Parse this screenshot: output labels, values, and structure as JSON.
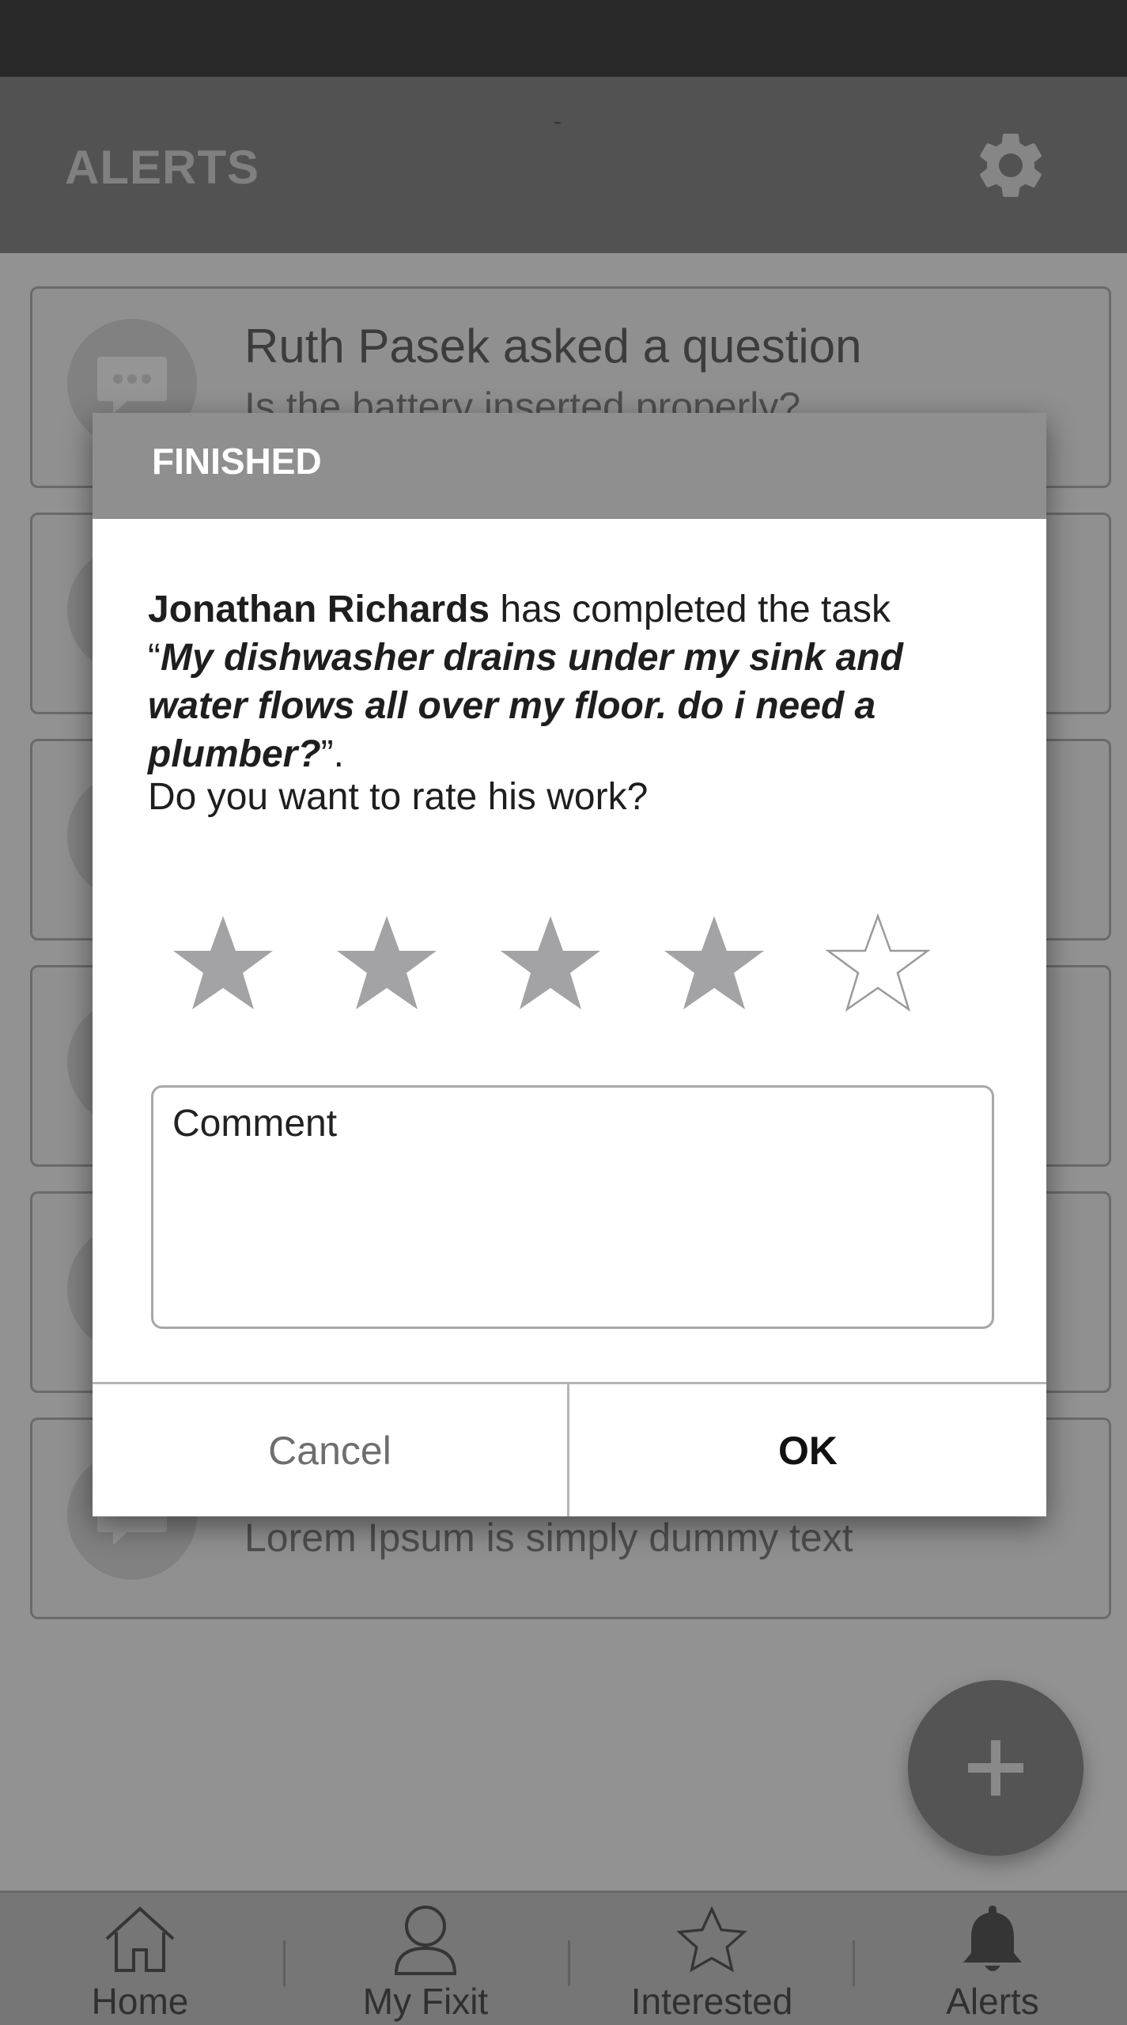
{
  "app_bar": {
    "title": "ALERTS",
    "center_mark": "-",
    "settings_icon": "gear-icon"
  },
  "alerts": [
    {
      "title": "Ruth Pasek asked a question",
      "subtitle": "Is the battery inserted properly?",
      "icon": "chat-bubble-icon"
    },
    {
      "title": "",
      "subtitle": "",
      "icon": "chat-bubble-icon"
    },
    {
      "title": "",
      "subtitle": "",
      "icon": "chat-bubble-icon"
    },
    {
      "title": "",
      "subtitle": "",
      "icon": "chat-bubble-icon"
    },
    {
      "title": "",
      "subtitle": "",
      "icon": "chat-bubble-icon"
    },
    {
      "title": "",
      "subtitle": "Lorem Ipsum is simply dummy text",
      "icon": "chat-bubble-icon"
    }
  ],
  "fab": {
    "icon": "plus-icon"
  },
  "bottom_nav": {
    "items": [
      {
        "label": "Home",
        "icon": "home-icon"
      },
      {
        "label": "My Fixit",
        "icon": "person-icon"
      },
      {
        "label": "Interested",
        "icon": "star-outline-icon"
      },
      {
        "label": "Alerts",
        "icon": "bell-icon"
      }
    ]
  },
  "dialog": {
    "title": "FINISHED",
    "worker_name": "Jonathan Richards",
    "completed_text": " has completed the task",
    "open_quote": "“",
    "task_text": "My dishwasher drains under my sink and water flows all over my floor. do i need a plumber?",
    "close_quote": "”.",
    "question": "Do you want to rate his work?",
    "rating": {
      "value": 4,
      "max": 5
    },
    "comment_placeholder": "Comment",
    "cancel_label": "Cancel",
    "ok_label": "OK"
  },
  "colors": {
    "star_filled": "#a3a3a6",
    "star_empty_stroke": "#9a9a9a",
    "header_bg": "#8f8f8f"
  }
}
